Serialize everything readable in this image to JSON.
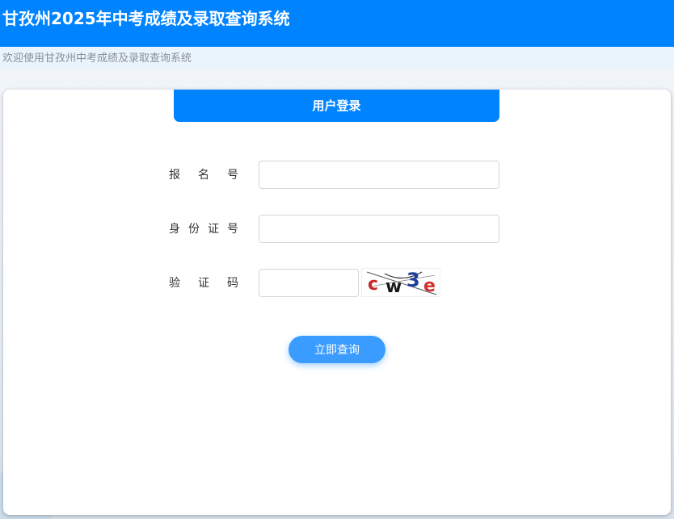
{
  "header": {
    "title": "甘孜州2025年中考成绩及录取查询系统"
  },
  "subbar": {
    "welcome_text": "欢迎使用甘孜州中考成绩及录取查询系统"
  },
  "login": {
    "tab_label": "用户登录",
    "fields": [
      {
        "label": "报名号",
        "value": "",
        "placeholder": ""
      },
      {
        "label": "身份证号",
        "value": "",
        "placeholder": ""
      },
      {
        "label": "验证码",
        "value": "",
        "placeholder": ""
      }
    ],
    "captcha": {
      "chars": [
        "c",
        "w",
        "3",
        "e"
      ],
      "colors": [
        "#c62828",
        "#1a1a1a",
        "#1f3f9a",
        "#d32f2f"
      ]
    },
    "submit_label": "立即查询"
  },
  "colors": {
    "primary": "#0083ff",
    "button": "#3a9cff",
    "subbar_bg": "#eaf4fd"
  }
}
